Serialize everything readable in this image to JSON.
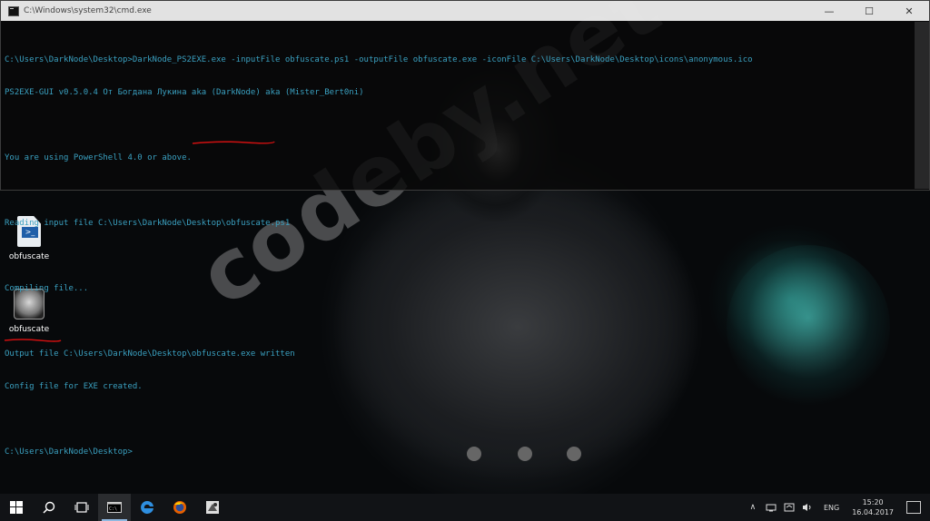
{
  "window": {
    "title": "C:\\Windows\\system32\\cmd.exe",
    "minimize": "—",
    "maximize": "☐",
    "close": "✕"
  },
  "terminal": {
    "lines": [
      "C:\\Users\\DarkNode\\Desktop>DarkNode_PS2EXE.exe -inputFile obfuscate.ps1 -outputFile obfuscate.exe -iconFile C:\\Users\\DarkNode\\Desktop\\icons\\anonymous.ico",
      "PS2EXE-GUI v0.5.0.4 От Богдана Лукина aka (DarkNode) aka (Mister_Bert0ni)",
      "",
      "You are using PowerShell 4.0 or above.",
      "",
      "Reading input file C:\\Users\\DarkNode\\Desktop\\obfuscate.ps1",
      "",
      "Compiling file...",
      "",
      "Output file C:\\Users\\DarkNode\\Desktop\\obfuscate.exe written",
      "Config file for EXE created.",
      "",
      "C:\\Users\\DarkNode\\Desktop>"
    ]
  },
  "desktop": {
    "icons": [
      {
        "label": "obfuscate",
        "type": "powershell-script"
      },
      {
        "label": "obfuscate",
        "type": "executable"
      }
    ],
    "watermark": "codeby.net"
  },
  "taskbar": {
    "language": "ENG",
    "time": "15:20",
    "date": "16.04.2017"
  },
  "colors": {
    "terminal_text": "#3aa0c0",
    "annotation_red": "#d01010",
    "taskbar_bg": "#111316"
  }
}
